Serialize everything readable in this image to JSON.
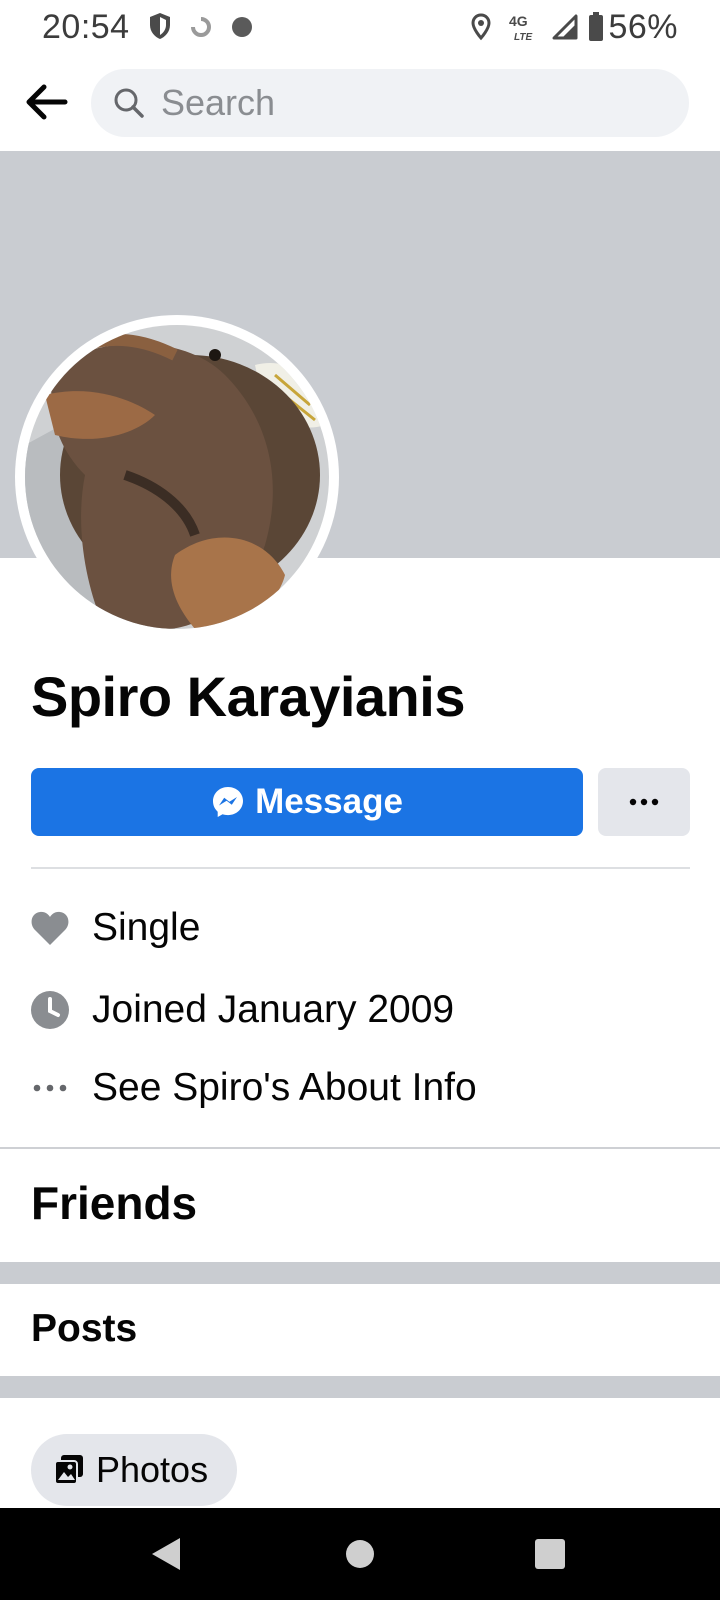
{
  "status_bar": {
    "time": "20:54",
    "network": "4G LTE",
    "battery": "56%"
  },
  "search": {
    "placeholder": "Search"
  },
  "profile": {
    "name": "Spiro Karayianis",
    "message_label": "Message",
    "more_label": "···"
  },
  "intro": {
    "relationship": "Single",
    "joined": "Joined January 2009",
    "about_link": "See Spiro's About Info"
  },
  "sections": {
    "friends": "Friends",
    "posts": "Posts",
    "photos": "Photos"
  },
  "colors": {
    "accent": "#1b74e4",
    "cover": "#c9ccd1"
  }
}
